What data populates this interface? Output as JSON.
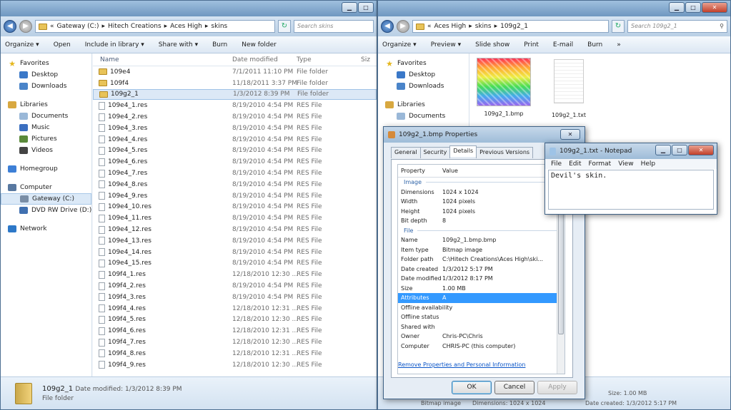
{
  "left": {
    "breadcrumb": [
      "«",
      "Gateway (C:)",
      "Hitech Creations",
      "Aces High",
      "skins"
    ],
    "search_placeholder": "Search skins",
    "toolbar": [
      "Organize ▾",
      "Open",
      "Include in library ▾",
      "Share with ▾",
      "Burn",
      "New folder"
    ],
    "nav": [
      {
        "label": "Favorites",
        "icon": "star-icon",
        "sub": false
      },
      {
        "label": "Desktop",
        "icon": "desktop-icon",
        "sub": true
      },
      {
        "label": "Downloads",
        "icon": "downloads-icon",
        "sub": true
      },
      {
        "label": "Libraries",
        "icon": "libraries-icon",
        "sub": false
      },
      {
        "label": "Documents",
        "icon": "documents-icon",
        "sub": true
      },
      {
        "label": "Music",
        "icon": "music-icon",
        "sub": true
      },
      {
        "label": "Pictures",
        "icon": "pictures-icon",
        "sub": true
      },
      {
        "label": "Videos",
        "icon": "videos-icon",
        "sub": true
      },
      {
        "label": "Homegroup",
        "icon": "homegroup-icon",
        "sub": false
      },
      {
        "label": "Computer",
        "icon": "computer-icon",
        "sub": false
      },
      {
        "label": "Gateway (C:)",
        "icon": "drive-icon",
        "sub": true
      },
      {
        "label": "DVD RW Drive (D:) B",
        "icon": "dvd-icon",
        "sub": true
      },
      {
        "label": "Network",
        "icon": "network-icon",
        "sub": false
      }
    ],
    "columns": [
      "Name",
      "Date modified",
      "Type",
      "Siz"
    ],
    "rows": [
      [
        "109e4",
        "7/1/2011 11:10 PM",
        "File folder",
        "folder"
      ],
      [
        "109f4",
        "11/18/2011 3:37 PM",
        "File folder",
        "folder"
      ],
      [
        "109g2_1",
        "1/3/2012 8:39 PM",
        "File folder",
        "folder"
      ],
      [
        "109e4_1.res",
        "8/19/2010 4:54 PM",
        "RES File",
        "file"
      ],
      [
        "109e4_2.res",
        "8/19/2010 4:54 PM",
        "RES File",
        "file"
      ],
      [
        "109e4_3.res",
        "8/19/2010 4:54 PM",
        "RES File",
        "file"
      ],
      [
        "109e4_4.res",
        "8/19/2010 4:54 PM",
        "RES File",
        "file"
      ],
      [
        "109e4_5.res",
        "8/19/2010 4:54 PM",
        "RES File",
        "file"
      ],
      [
        "109e4_6.res",
        "8/19/2010 4:54 PM",
        "RES File",
        "file"
      ],
      [
        "109e4_7.res",
        "8/19/2010 4:54 PM",
        "RES File",
        "file"
      ],
      [
        "109e4_8.res",
        "8/19/2010 4:54 PM",
        "RES File",
        "file"
      ],
      [
        "109e4_9.res",
        "8/19/2010 4:54 PM",
        "RES File",
        "file"
      ],
      [
        "109e4_10.res",
        "8/19/2010 4:54 PM",
        "RES File",
        "file"
      ],
      [
        "109e4_11.res",
        "8/19/2010 4:54 PM",
        "RES File",
        "file"
      ],
      [
        "109e4_12.res",
        "8/19/2010 4:54 PM",
        "RES File",
        "file"
      ],
      [
        "109e4_13.res",
        "8/19/2010 4:54 PM",
        "RES File",
        "file"
      ],
      [
        "109e4_14.res",
        "8/19/2010 4:54 PM",
        "RES File",
        "file"
      ],
      [
        "109e4_15.res",
        "8/19/2010 4:54 PM",
        "RES File",
        "file"
      ],
      [
        "109f4_1.res",
        "12/18/2010 12:30 ...",
        "RES File",
        "file"
      ],
      [
        "109f4_2.res",
        "8/19/2010 4:54 PM",
        "RES File",
        "file"
      ],
      [
        "109f4_3.res",
        "8/19/2010 4:54 PM",
        "RES File",
        "file"
      ],
      [
        "109f4_4.res",
        "12/18/2010 12:31 ...",
        "RES File",
        "file"
      ],
      [
        "109f4_5.res",
        "12/18/2010 12:30 ...",
        "RES File",
        "file"
      ],
      [
        "109f4_6.res",
        "12/18/2010 12:31 ...",
        "RES File",
        "file"
      ],
      [
        "109f4_7.res",
        "12/18/2010 12:30 ...",
        "RES File",
        "file"
      ],
      [
        "109f4_8.res",
        "12/18/2010 12:31 ...",
        "RES File",
        "file"
      ],
      [
        "109f4_9.res",
        "12/18/2010 12:30 ...",
        "RES File",
        "file"
      ]
    ],
    "details": {
      "name": "109g2_1",
      "modified": "Date modified: 1/3/2012 8:39 PM",
      "type": "File folder"
    }
  },
  "right": {
    "breadcrumb": [
      "«",
      "Aces High",
      "skins",
      "109g2_1"
    ],
    "search_placeholder": "Search 109g2_1",
    "toolbar": [
      "Organize ▾",
      "Preview ▾",
      "Slide show",
      "Print",
      "E-mail",
      "Burn",
      "»"
    ],
    "nav": [
      {
        "label": "Favorites",
        "icon": "star-icon",
        "sub": false
      },
      {
        "label": "Desktop",
        "icon": "desktop-icon",
        "sub": true
      },
      {
        "label": "Downloads",
        "icon": "downloads-icon",
        "sub": true
      },
      {
        "label": "Libraries",
        "icon": "libraries-icon",
        "sub": false
      },
      {
        "label": "Documents",
        "icon": "documents-icon",
        "sub": true
      }
    ],
    "files": [
      "109g2_1.bmp",
      "109g2_1.txt"
    ],
    "status_type": "Bitmap image",
    "status_dims": "Dimensions: 1024 x 1024",
    "status_size": "Size: 1.00 MB",
    "status_created": "Date created: 1/3/2012 5:17 PM"
  },
  "props": {
    "title": "109g2_1.bmp Properties",
    "tabs": [
      "General",
      "Security",
      "Details",
      "Previous Versions"
    ],
    "headers": [
      "Property",
      "Value"
    ],
    "rows": [
      [
        "grp",
        "Image",
        ""
      ],
      [
        "kv",
        "Dimensions",
        "1024 x 1024"
      ],
      [
        "kv",
        "Width",
        "1024 pixels"
      ],
      [
        "kv",
        "Height",
        "1024 pixels"
      ],
      [
        "kv",
        "Bit depth",
        "8"
      ],
      [
        "grp",
        "File",
        ""
      ],
      [
        "kv",
        "Name",
        "109g2_1.bmp.bmp"
      ],
      [
        "kv",
        "Item type",
        "Bitmap image"
      ],
      [
        "kv",
        "Folder path",
        "C:\\Hitech Creations\\Aces High\\ski..."
      ],
      [
        "kv",
        "Date created",
        "1/3/2012 5:17 PM"
      ],
      [
        "kv",
        "Date modified",
        "1/3/2012 8:17 PM"
      ],
      [
        "kv",
        "Size",
        "1.00 MB"
      ],
      [
        "sel",
        "Attributes",
        "A"
      ],
      [
        "kv",
        "Offline availability",
        ""
      ],
      [
        "kv",
        "Offline status",
        ""
      ],
      [
        "kv",
        "Shared with",
        ""
      ],
      [
        "kv",
        "Owner",
        "Chris-PC\\Chris"
      ],
      [
        "kv",
        "Computer",
        "CHRIS-PC (this computer)"
      ]
    ],
    "link": "Remove Properties and Personal Information",
    "ok": "OK",
    "cancel": "Cancel",
    "apply": "Apply"
  },
  "notepad": {
    "title": "109g2_1.txt - Notepad",
    "menu": [
      "File",
      "Edit",
      "Format",
      "View",
      "Help"
    ],
    "content": "Devil's skin."
  }
}
